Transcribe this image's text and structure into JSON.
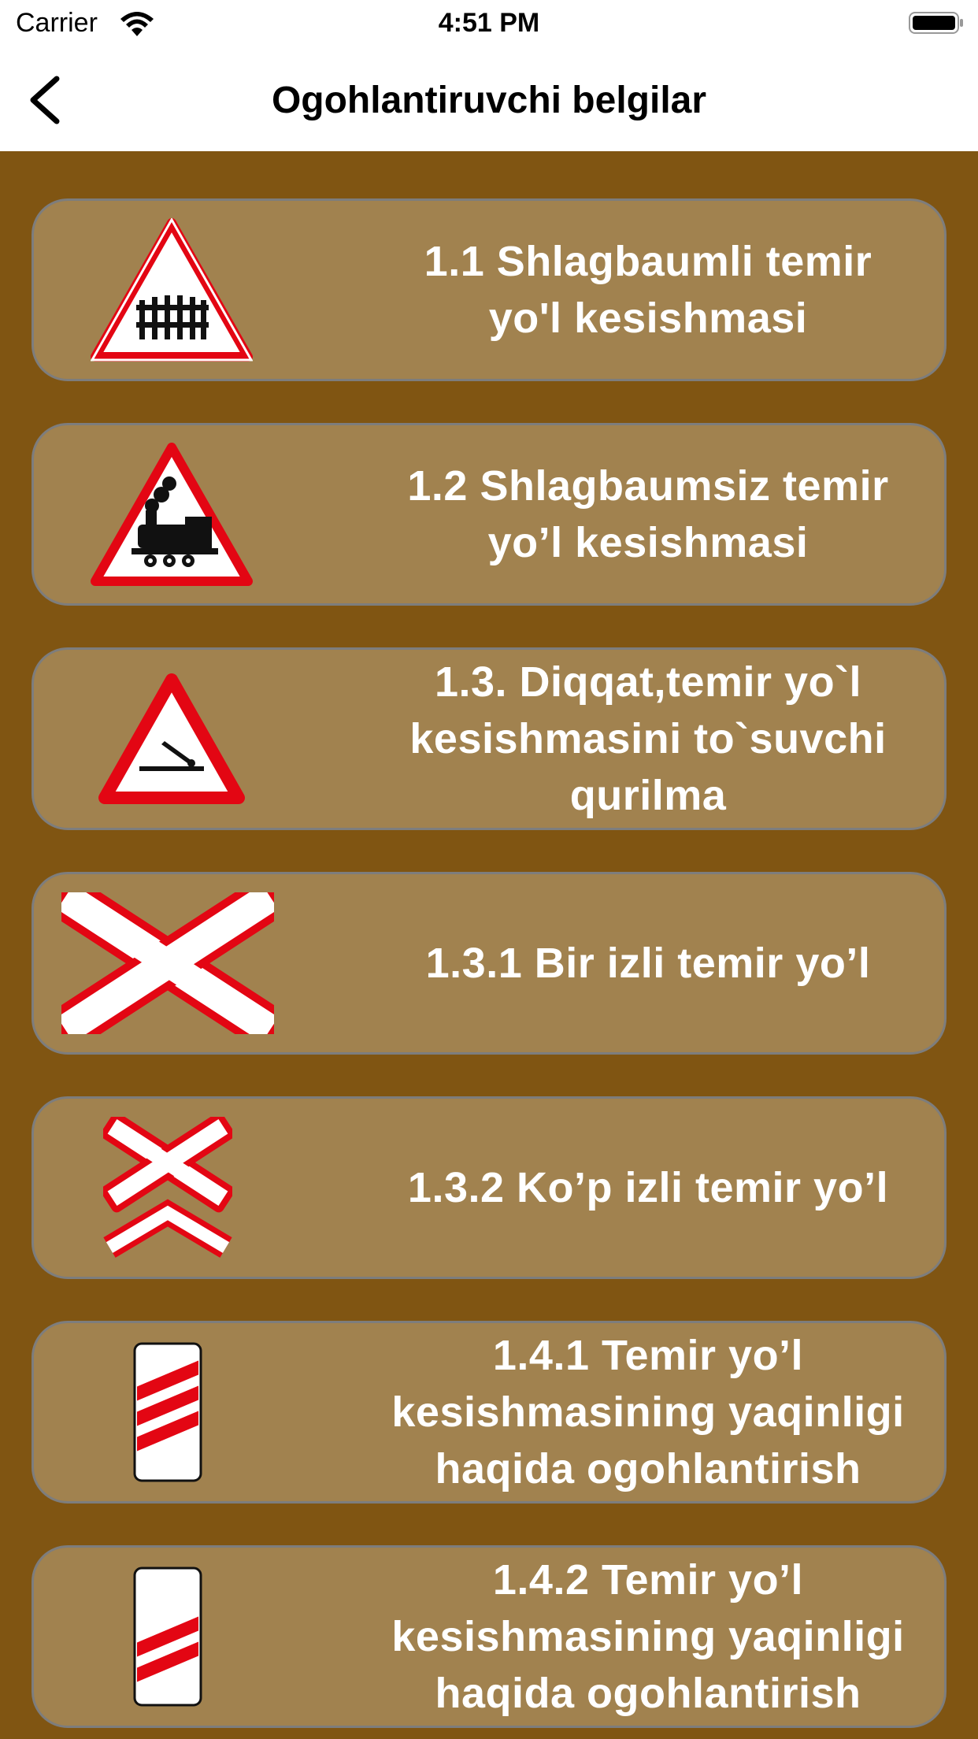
{
  "status_bar": {
    "carrier": "Carrier",
    "time": "4:51 PM",
    "wifi_icon": "wifi-icon",
    "battery_icon": "battery-full-icon"
  },
  "nav": {
    "title": "Ogohlantiruvchi belgilar",
    "back_icon": "chevron-left-icon"
  },
  "colors": {
    "background": "#805512",
    "card": "#a1824f",
    "card_border": "#7d7d7d",
    "sign_red": "#e30613"
  },
  "signs": [
    {
      "label": "1.1 Shlagbaumli temir\nyo'l kesishmasi",
      "icon": "railway-crossing-with-barrier-sign-icon"
    },
    {
      "label": "1.2 Shlagbaumsiz temir\nyo’l kesishmasi",
      "icon": "railway-crossing-without-barrier-sign-icon"
    },
    {
      "label": "1.3. Diqqat,temir yo`l\nkesishmasini to`suvchi\nqurilma",
      "icon": "railway-barrier-device-sign-icon"
    },
    {
      "label": "1.3.1 Bir izli temir yo’l",
      "icon": "single-track-railway-cross-sign-icon"
    },
    {
      "label": "1.3.2 Ko’p izli temir yo’l",
      "icon": "multi-track-railway-cross-sign-icon"
    },
    {
      "label": "1.4.1 Temir yo’l\nkesishmasining yaqinligi\nhaqida ogohlantirish",
      "icon": "railway-approach-three-stripes-sign-icon"
    },
    {
      "label": "1.4.2 Temir yo’l\nkesishmasining yaqinligi\nhaqida ogohlantirish",
      "icon": "railway-approach-two-stripes-sign-icon"
    }
  ]
}
